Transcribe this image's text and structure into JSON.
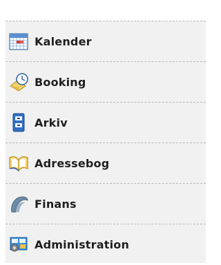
{
  "nav": {
    "items": [
      {
        "label": "Kalender",
        "icon": "calendar-icon"
      },
      {
        "label": "Booking",
        "icon": "booking-icon"
      },
      {
        "label": "Arkiv",
        "icon": "archive-icon"
      },
      {
        "label": "Adressebog",
        "icon": "address-book-icon"
      },
      {
        "label": "Finans",
        "icon": "finance-icon"
      },
      {
        "label": "Administration",
        "icon": "administration-icon"
      }
    ]
  }
}
